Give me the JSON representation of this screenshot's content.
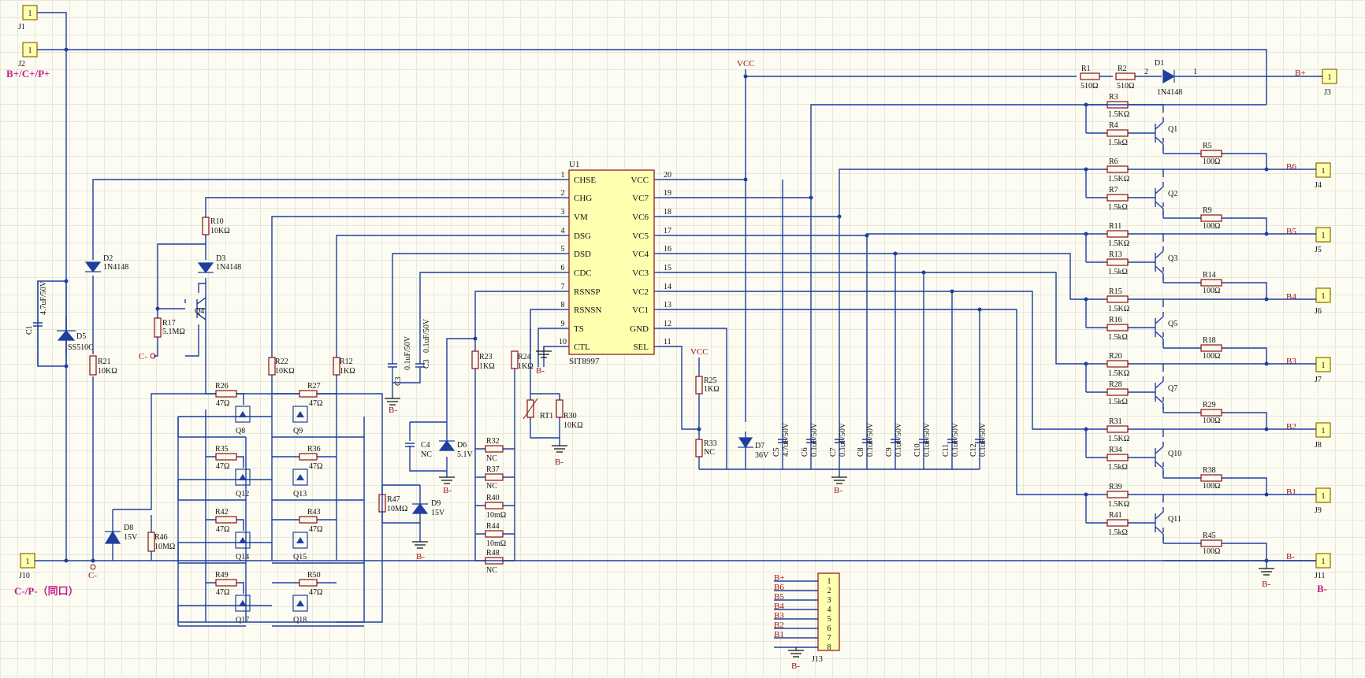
{
  "ic": {
    "ref": "U1",
    "part": "SIT8997",
    "left": [
      {
        "pin": "1",
        "name": "CHSE"
      },
      {
        "pin": "2",
        "name": "CHG"
      },
      {
        "pin": "3",
        "name": "VM"
      },
      {
        "pin": "4",
        "name": "DSG"
      },
      {
        "pin": "5",
        "name": "DSD"
      },
      {
        "pin": "6",
        "name": "CDC"
      },
      {
        "pin": "7",
        "name": "RSNSP"
      },
      {
        "pin": "8",
        "name": "RSNSN"
      },
      {
        "pin": "9",
        "name": "TS"
      },
      {
        "pin": "10",
        "name": "CTL"
      }
    ],
    "right": [
      {
        "pin": "20",
        "name": "VCC"
      },
      {
        "pin": "19",
        "name": "VC7"
      },
      {
        "pin": "18",
        "name": "VC6"
      },
      {
        "pin": "17",
        "name": "VC5"
      },
      {
        "pin": "16",
        "name": "VC4"
      },
      {
        "pin": "15",
        "name": "VC3"
      },
      {
        "pin": "14",
        "name": "VC2"
      },
      {
        "pin": "13",
        "name": "VC1"
      },
      {
        "pin": "12",
        "name": "GND"
      },
      {
        "pin": "11",
        "name": "SEL"
      }
    ]
  },
  "connectors": [
    {
      "ref": "J1",
      "pin": "1"
    },
    {
      "ref": "J2",
      "pin": "1"
    },
    {
      "ref": "J10",
      "pin": "1"
    },
    {
      "ref": "J3",
      "pin": "1"
    },
    {
      "ref": "J4",
      "pin": "1"
    },
    {
      "ref": "J5",
      "pin": "1"
    },
    {
      "ref": "J6",
      "pin": "1"
    },
    {
      "ref": "J7",
      "pin": "1"
    },
    {
      "ref": "J8",
      "pin": "1"
    },
    {
      "ref": "J9",
      "pin": "1"
    },
    {
      "ref": "J11",
      "pin": "1"
    }
  ],
  "header": {
    "ref": "J13",
    "pins": [
      "1",
      "2",
      "3",
      "4",
      "5",
      "6",
      "7",
      "8"
    ],
    "nets": [
      "B+",
      "B6",
      "B5",
      "B4",
      "B3",
      "B2",
      "B1"
    ],
    "ground": "B-"
  },
  "netlabels": {
    "bplus_cplus": "B+/C+/P+",
    "cminus": "C-/P-（同口）",
    "bminus_pink": "B-",
    "bplus": "B+",
    "b6": "B6",
    "b5": "B5",
    "b4": "B4",
    "b3": "B3",
    "b2": "B2",
    "b1": "B1",
    "bminus": "B-",
    "cnode": "C-",
    "cnode2": "C-",
    "vcc": "VCC"
  },
  "ground_labels": [
    "B-",
    "B-",
    "B-",
    "B-",
    "B-",
    "B-",
    "B-"
  ],
  "parts": {
    "R1": {
      "ref": "R1",
      "val": "510Ω"
    },
    "R2": {
      "ref": "R2",
      "val": "510Ω"
    },
    "D1": {
      "ref": "D1",
      "val": "1N4148"
    },
    "R3": {
      "ref": "R3",
      "val": "1.5KΩ"
    },
    "R4": {
      "ref": "R4",
      "val": "1.5kΩ"
    },
    "Q1": {
      "ref": "Q1"
    },
    "R5": {
      "ref": "R5",
      "val": "100Ω"
    },
    "R6": {
      "ref": "R6",
      "val": "1.5KΩ"
    },
    "R7": {
      "ref": "R7",
      "val": "1.5kΩ"
    },
    "Q2": {
      "ref": "Q2"
    },
    "R9": {
      "ref": "R9",
      "val": "100Ω"
    },
    "R11": {
      "ref": "R11",
      "val": "1.5KΩ"
    },
    "R13": {
      "ref": "R13",
      "val": "1.5kΩ"
    },
    "Q3": {
      "ref": "Q3"
    },
    "R14": {
      "ref": "R14",
      "val": "100Ω"
    },
    "R15": {
      "ref": "R15",
      "val": "1.5KΩ"
    },
    "R16": {
      "ref": "R16",
      "val": "1.5kΩ"
    },
    "Q5": {
      "ref": "Q5"
    },
    "R18": {
      "ref": "R18",
      "val": "100Ω"
    },
    "R20": {
      "ref": "R20",
      "val": "1.5KΩ"
    },
    "R28": {
      "ref": "R28",
      "val": "1.5kΩ"
    },
    "Q7": {
      "ref": "Q7"
    },
    "R29": {
      "ref": "R29",
      "val": "100Ω"
    },
    "R31": {
      "ref": "R31",
      "val": "1.5KΩ"
    },
    "R34": {
      "ref": "R34",
      "val": "1.5kΩ"
    },
    "Q10": {
      "ref": "Q10"
    },
    "R38": {
      "ref": "R38",
      "val": "100Ω"
    },
    "R39": {
      "ref": "R39",
      "val": "1.5KΩ"
    },
    "R41": {
      "ref": "R41",
      "val": "1.5kΩ"
    },
    "Q11": {
      "ref": "Q11"
    },
    "R45": {
      "ref": "R45",
      "val": "100Ω"
    },
    "C1": {
      "ref": "C1",
      "val": "4.7uF/50V"
    },
    "D5": {
      "ref": "D5",
      "val": "SS510C"
    },
    "D2": {
      "ref": "D2",
      "val": "1N4148"
    },
    "R21": {
      "ref": "R21",
      "val": "10KΩ"
    },
    "R10": {
      "ref": "R10",
      "val": "10KΩ"
    },
    "D3": {
      "ref": "D3",
      "val": "1N4148"
    },
    "Q4": {
      "ref": "Q4"
    },
    "R17": {
      "ref": "R17",
      "val": "5.1MΩ"
    },
    "R22": {
      "ref": "R22",
      "val": "10KΩ"
    },
    "R12": {
      "ref": "R12",
      "val": "1KΩ"
    },
    "D8": {
      "ref": "D8",
      "val": "15V"
    },
    "R46": {
      "ref": "R46",
      "val": "10MΩ"
    },
    "C3a": {
      "ref": "C3",
      "val": "0.1uF/50V"
    },
    "C3b": {
      "ref": "C3",
      "val": "0.1uF/50V"
    },
    "C4": {
      "ref": "C4",
      "val": "NC"
    },
    "D6": {
      "ref": "D6",
      "val": "5.1V"
    },
    "R23": {
      "ref": "R23",
      "val": "1KΩ"
    },
    "R24": {
      "ref": "R24",
      "val": "1KΩ"
    },
    "R32": {
      "ref": "R32",
      "val": "NC"
    },
    "R37": {
      "ref": "R37",
      "val": "NC"
    },
    "R40": {
      "ref": "R40",
      "val": "10mΩ"
    },
    "R44": {
      "ref": "R44",
      "val": "10mΩ"
    },
    "R48": {
      "ref": "R48",
      "val": "NC"
    },
    "RT1": {
      "ref": "RT1"
    },
    "R30": {
      "ref": "R30",
      "val": "10KΩ"
    },
    "R47": {
      "ref": "R47",
      "val": "10MΩ"
    },
    "D9": {
      "ref": "D9",
      "val": "15V"
    },
    "R25": {
      "ref": "R25",
      "val": "1KΩ"
    },
    "R33": {
      "ref": "R33",
      "val": "NC"
    },
    "D7": {
      "ref": "D7",
      "val": "36V"
    },
    "C5": {
      "ref": "C5",
      "val": "4.7uF/50V"
    },
    "C6": {
      "ref": "C6",
      "val": "0.1uF/50V"
    },
    "C7": {
      "ref": "C7",
      "val": "0.1uF/50V"
    },
    "C8": {
      "ref": "C8",
      "val": "0.1uF/50V"
    },
    "C9": {
      "ref": "C9",
      "val": "0.1uF/50V"
    },
    "C10": {
      "ref": "C10",
      "val": "0.1uF/50V"
    },
    "C11": {
      "ref": "C11",
      "val": "0.1uF/50V"
    },
    "C12": {
      "ref": "C12",
      "val": "0.1uF/50V"
    },
    "R26": {
      "ref": "R26",
      "val": "47Ω"
    },
    "R27": {
      "ref": "R27",
      "val": "47Ω"
    },
    "R35": {
      "ref": "R35",
      "val": "47Ω"
    },
    "R36": {
      "ref": "R36",
      "val": "47Ω"
    },
    "R42": {
      "ref": "R42",
      "val": "47Ω"
    },
    "R43": {
      "ref": "R43",
      "val": "47Ω"
    },
    "R49": {
      "ref": "R49",
      "val": "47Ω"
    },
    "R50": {
      "ref": "R50",
      "val": "47Ω"
    },
    "Q8": {
      "ref": "Q8"
    },
    "Q9": {
      "ref": "Q9"
    },
    "Q12": {
      "ref": "Q12"
    },
    "Q13": {
      "ref": "Q13"
    },
    "Q14": {
      "ref": "Q14"
    },
    "Q15": {
      "ref": "Q15"
    },
    "Q17": {
      "ref": "Q17"
    },
    "Q18": {
      "ref": "Q18"
    }
  }
}
